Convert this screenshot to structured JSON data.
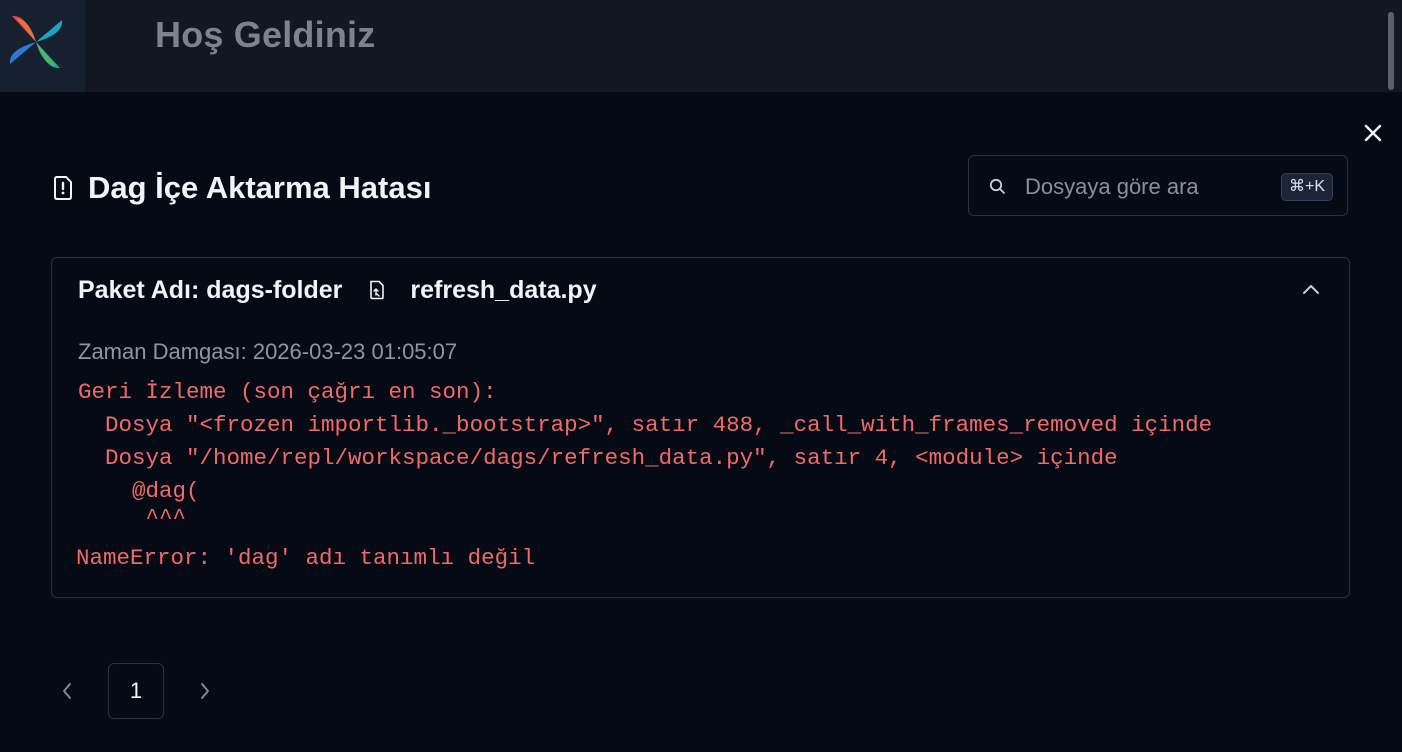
{
  "header": {
    "welcome_title": "Hoş Geldiniz"
  },
  "modal": {
    "title": "Dag İçe Aktarma Hatası",
    "close_label": "×",
    "search": {
      "placeholder": "Dosyaya göre ara",
      "shortcut": "⌘+K"
    },
    "error_card": {
      "bundle_label": "Paket Adı: dags-folder",
      "file_name": "refresh_data.py",
      "timestamp": "Zaman Damgası: 2026-03-23 01:05:07",
      "traceback": [
        "Geri İzleme (son çağrı en son):",
        "  Dosya \"<frozen importlib._bootstrap>\", satır 488, _call_with_frames_removed içinde",
        "  Dosya \"/home/repl/workspace/dags/refresh_data.py\", satır 4, <module> içinde",
        "    @dag(",
        "     ^^^"
      ],
      "error_line": "NameError: 'dag' adı tanımlı değil"
    },
    "pagination": {
      "current_page": "1"
    }
  },
  "colors": {
    "background": "#060a14",
    "header_bg": "#121722",
    "border": "#2a313e",
    "error_text": "#f16a6a",
    "muted_text": "#9096a0"
  }
}
